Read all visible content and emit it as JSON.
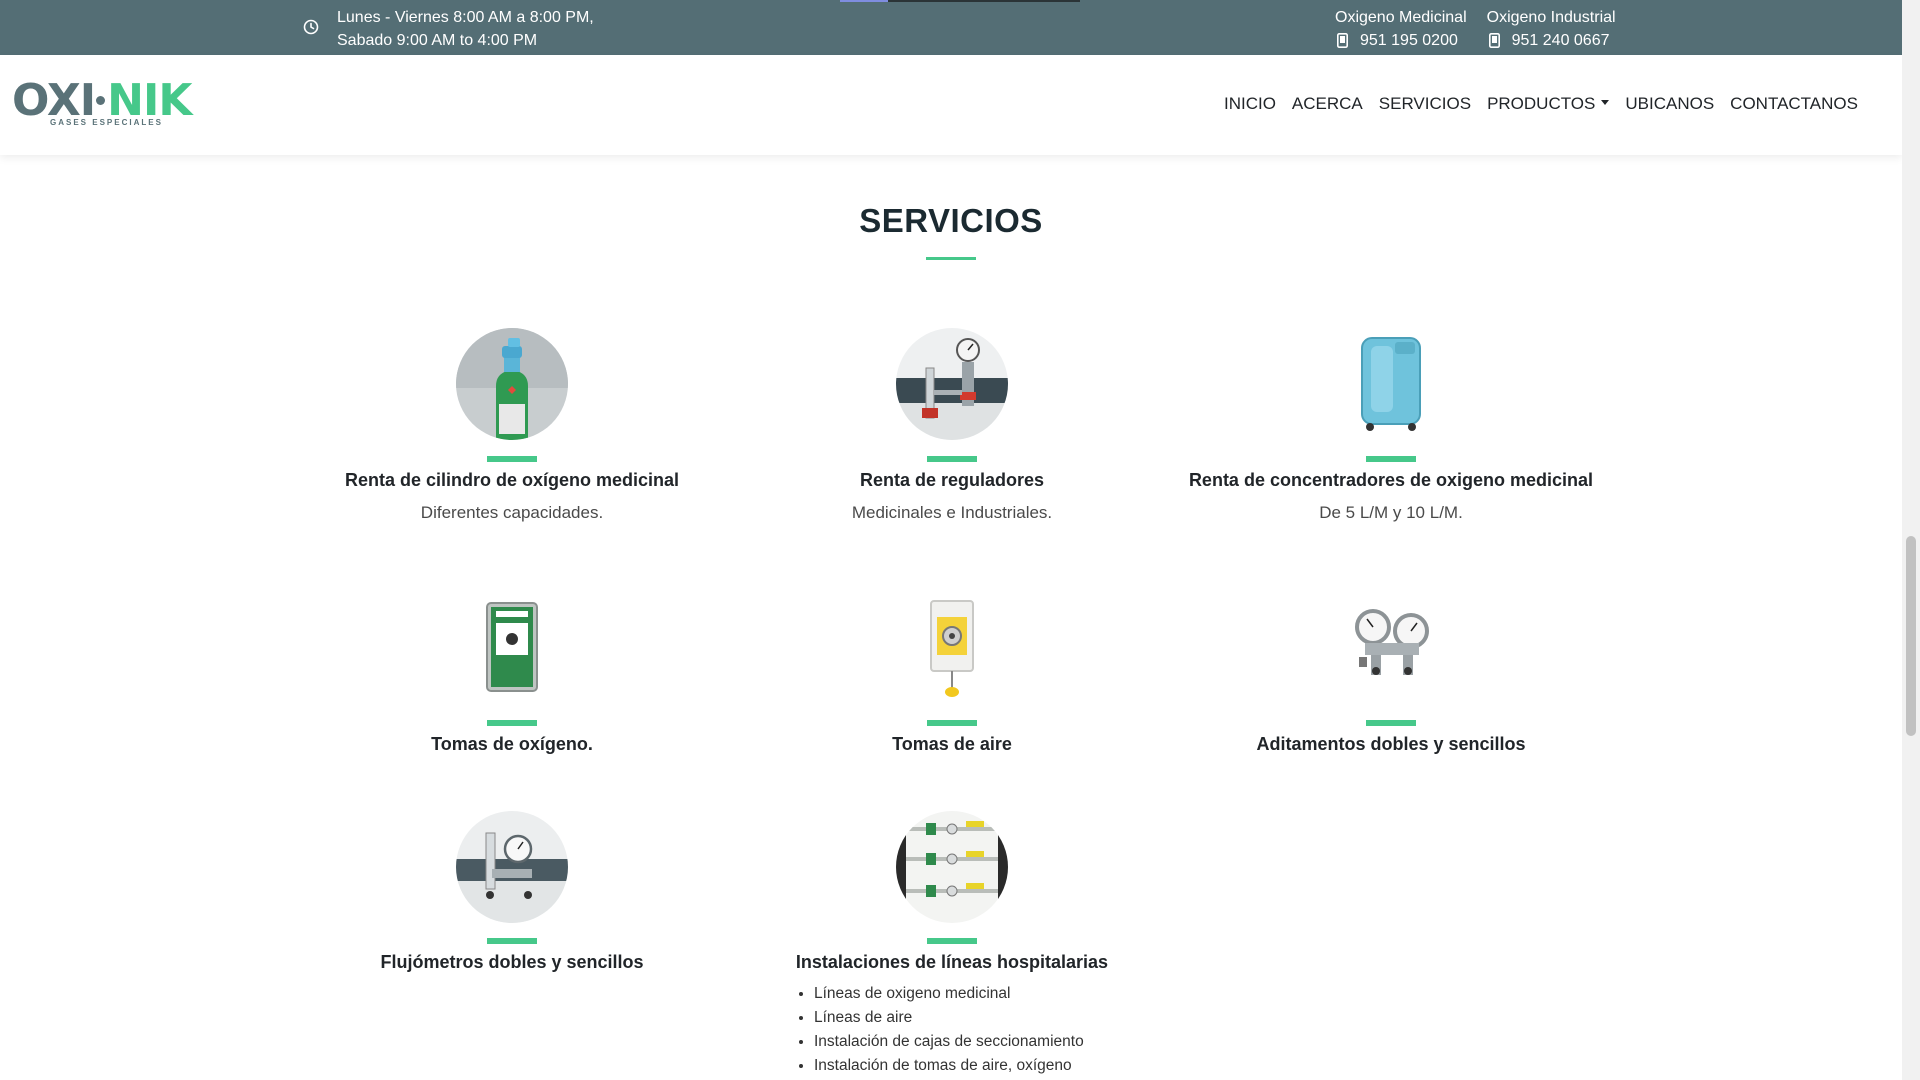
{
  "topbar": {
    "hours_line1": "Lunes - Viernes 8:00 AM a 8:00 PM,",
    "hours_line2": "Sabado 9:00 AM to 4:00 PM",
    "phones": [
      {
        "label": "Oxigeno Medicinal",
        "number": "951 195 0200"
      },
      {
        "label": "Oxigeno Industrial",
        "number": "951 240 0667"
      }
    ],
    "bg_color": "#546e75"
  },
  "logo": {
    "part1": "OXI",
    "part2": "NIK",
    "tagline": "GASES ESPECIALES"
  },
  "nav": {
    "items": [
      "INICIO",
      "ACERCA",
      "SERVICIOS",
      "PRODUCTOS",
      "UBICANOS",
      "CONTACTANOS"
    ]
  },
  "section": {
    "title": "SERVICIOS",
    "accent_color": "#46c88a"
  },
  "services": [
    {
      "title": "Renta de cilindro de oxígeno medicinal",
      "desc": "Diferentes capacidades."
    },
    {
      "title": "Renta de reguladores",
      "desc": "Medicinales e Industriales."
    },
    {
      "title": "Renta de concentradores de oxigeno medicinal",
      "desc": "De 5 L/M y 10 L/M."
    },
    {
      "title": "Tomas de oxígeno."
    },
    {
      "title": "Tomas de aire"
    },
    {
      "title": "Aditamentos dobles y sencillos"
    },
    {
      "title": "Flujómetros dobles y sencillos"
    },
    {
      "title": "Instalaciones de líneas hospitalarias",
      "list": [
        "Líneas de oxigeno medicinal",
        "Líneas de aire",
        "Instalación de cajas de seccionamiento",
        "Instalación de tomas de aire, oxígeno"
      ]
    }
  ]
}
